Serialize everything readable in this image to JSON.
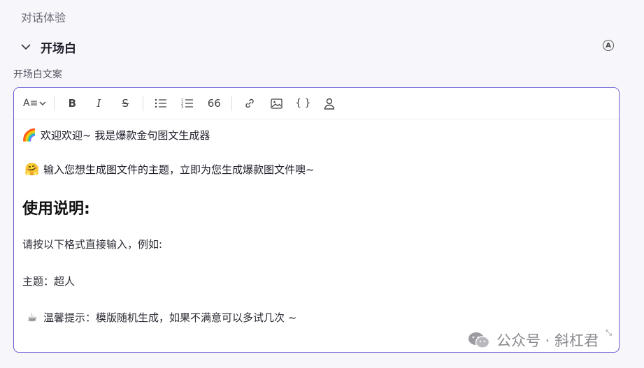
{
  "section": {
    "title": "对话体验"
  },
  "collapse": {
    "title": "开场白",
    "badge": "A"
  },
  "field": {
    "label": "开场白文案"
  },
  "toolbar": {
    "icons": [
      "font-size-icon",
      "bold-icon",
      "italic-icon",
      "strikethrough-icon",
      "bullet-list-icon",
      "ordered-list-icon",
      "quote-icon",
      "link-icon",
      "image-icon",
      "code-block-icon",
      "user-icon"
    ],
    "font_glyph": "A≡",
    "bold": "B",
    "italic": "I",
    "strike": "S",
    "quote": "66",
    "code": "{ }"
  },
  "content": {
    "line1_emoji": "🌈",
    "line1": "欢迎欢迎~ 我是爆款金句图文生成器",
    "line2_emoji": "🤗",
    "line2": "输入您想生成图文件的主题，立即为您生成爆款图文件噢~",
    "heading": "使用说明:",
    "para1": "请按以下格式直接输入，例如:",
    "para2": "主题：超人",
    "line3_emoji": "☕",
    "line3": "温馨提示：模版随机生成，如果不满意可以多试几次 ~"
  },
  "watermark": {
    "text": "公众号 · 斜杠君"
  }
}
